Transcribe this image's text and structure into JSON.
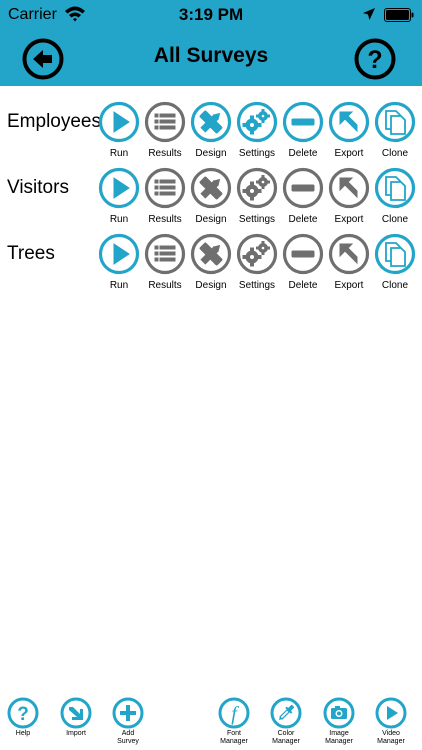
{
  "status": {
    "carrier": "Carrier",
    "time": "3:19 PM"
  },
  "header": {
    "title": "All Surveys"
  },
  "rows": [
    {
      "name": "Employees"
    },
    {
      "name": "Visitors"
    },
    {
      "name": "Trees"
    }
  ],
  "actions": [
    "Run",
    "Results",
    "Design",
    "Settings",
    "Delete",
    "Export",
    "Clone"
  ],
  "toolbar": {
    "help": "Help",
    "import": "Import",
    "add_survey_1": "Add",
    "add_survey_2": "Survey",
    "font_manager_1": "Font",
    "font_manager_2": "Manager",
    "color_manager_1": "Color",
    "color_manager_2": "Manager",
    "image_manager_1": "Image",
    "image_manager_2": "Manager",
    "video_manager_1": "Video",
    "video_manager_2": "Manager"
  },
  "colors": {
    "accent": "#22a5c9",
    "gray": "#6f6f6f",
    "header_text": "#000000"
  }
}
